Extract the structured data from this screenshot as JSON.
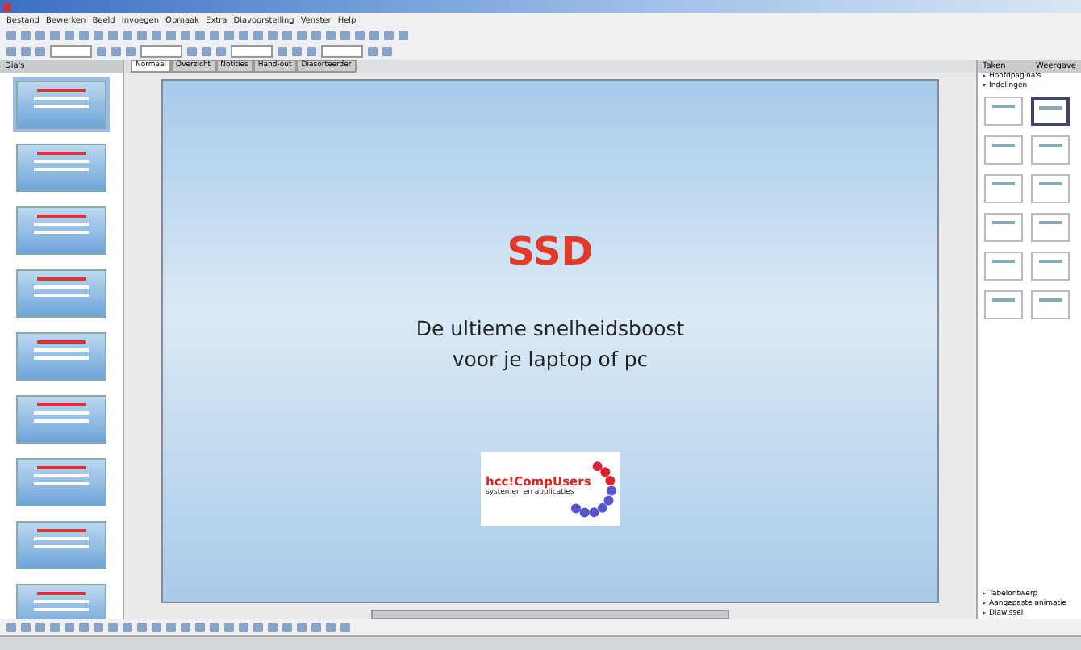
{
  "menu": [
    "Bestand",
    "Bewerken",
    "Beeld",
    "Invoegen",
    "Opmaak",
    "Extra",
    "Diavoorstelling",
    "Venster",
    "Help"
  ],
  "slides_panel": {
    "title": "Dia's",
    "slides": [
      {
        "selected": true
      },
      {
        "selected": false
      },
      {
        "selected": false
      },
      {
        "selected": false
      },
      {
        "selected": false
      },
      {
        "selected": false
      },
      {
        "selected": false
      },
      {
        "selected": false
      },
      {
        "selected": false
      }
    ]
  },
  "view_tabs": [
    {
      "label": "Normaal",
      "selected": true
    },
    {
      "label": "Overzicht",
      "selected": false
    },
    {
      "label": "Notities",
      "selected": false
    },
    {
      "label": "Hand-out",
      "selected": false
    },
    {
      "label": "Diasorteerder",
      "selected": false
    }
  ],
  "slide": {
    "title": "SSD",
    "subtitle": "De ultieme snelheidsboost voor je laptop of pc",
    "logo": {
      "name": "hcc!CompUsers",
      "tagline": "systemen en applicaties"
    }
  },
  "tasks_panel": {
    "title": "Taken",
    "view_menu": "Weergave",
    "top_sections": [
      {
        "label": "Hoofdpagina's",
        "expanded": false
      },
      {
        "label": "Indelingen",
        "expanded": true
      }
    ],
    "layouts": [
      {
        "selected": false
      },
      {
        "selected": true
      },
      {
        "selected": false
      },
      {
        "selected": false
      },
      {
        "selected": false
      },
      {
        "selected": false
      },
      {
        "selected": false
      },
      {
        "selected": false
      },
      {
        "selected": false
      },
      {
        "selected": false
      },
      {
        "selected": false
      },
      {
        "selected": false
      }
    ],
    "bottom_sections": [
      {
        "label": "Tabelontwerp",
        "expanded": false
      },
      {
        "label": "Aangepaste animatie",
        "expanded": false
      },
      {
        "label": "Diawissel",
        "expanded": false
      }
    ]
  }
}
